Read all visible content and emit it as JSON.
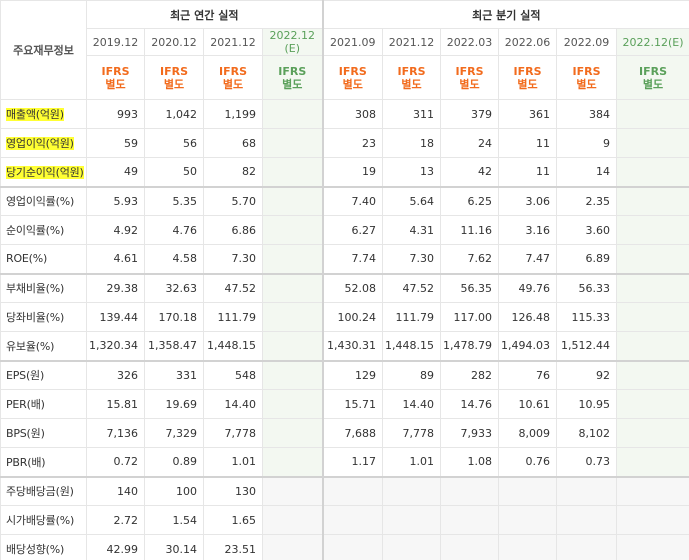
{
  "corner_label": "주요재무정보",
  "group_annual": "최근 연간 실적",
  "group_quarterly": "최근 분기 실적",
  "ifrs_label": "IFRS",
  "separate_label": "별도",
  "columns": [
    {
      "date": "2019.12",
      "est": ""
    },
    {
      "date": "2020.12",
      "est": ""
    },
    {
      "date": "2021.12",
      "est": ""
    },
    {
      "date": "2022.12",
      "est": "(E)"
    },
    {
      "date": "2021.09",
      "est": ""
    },
    {
      "date": "2021.12",
      "est": ""
    },
    {
      "date": "2022.03",
      "est": ""
    },
    {
      "date": "2022.06",
      "est": ""
    },
    {
      "date": "2022.09",
      "est": ""
    },
    {
      "date": "2022.12(E)",
      "est": ""
    }
  ],
  "highlight_color": "#ffff33",
  "accent_color": "#f26b1d",
  "rows": [
    {
      "label": "매출액(억원)",
      "hl": true,
      "values": [
        "993",
        "1,042",
        "1,199",
        "",
        "308",
        "311",
        "379",
        "361",
        "384",
        ""
      ]
    },
    {
      "label": "영업이익(억원)",
      "hl": true,
      "values": [
        "59",
        "56",
        "68",
        "",
        "23",
        "18",
        "24",
        "11",
        "9",
        ""
      ]
    },
    {
      "label": "당기순이익(억원)",
      "hl": true,
      "values": [
        "49",
        "50",
        "82",
        "",
        "19",
        "13",
        "42",
        "11",
        "14",
        ""
      ]
    },
    {
      "label": "영업이익률(%)",
      "hl": false,
      "sep": true,
      "values": [
        "5.93",
        "5.35",
        "5.70",
        "",
        "7.40",
        "5.64",
        "6.25",
        "3.06",
        "2.35",
        ""
      ]
    },
    {
      "label": "순이익률(%)",
      "hl": false,
      "values": [
        "4.92",
        "4.76",
        "6.86",
        "",
        "6.27",
        "4.31",
        "11.16",
        "3.16",
        "3.60",
        ""
      ]
    },
    {
      "label": "ROE(%)",
      "hl": false,
      "values": [
        "4.61",
        "4.58",
        "7.30",
        "",
        "7.74",
        "7.30",
        "7.62",
        "7.47",
        "6.89",
        ""
      ]
    },
    {
      "label": "부채비율(%)",
      "hl": false,
      "sep": true,
      "values": [
        "29.38",
        "32.63",
        "47.52",
        "",
        "52.08",
        "47.52",
        "56.35",
        "49.76",
        "56.33",
        ""
      ]
    },
    {
      "label": "당좌비율(%)",
      "hl": false,
      "values": [
        "139.44",
        "170.18",
        "111.79",
        "",
        "100.24",
        "111.79",
        "117.00",
        "126.48",
        "115.33",
        ""
      ]
    },
    {
      "label": "유보율(%)",
      "hl": false,
      "values": [
        "1,320.34",
        "1,358.47",
        "1,448.15",
        "",
        "1,430.31",
        "1,448.15",
        "1,478.79",
        "1,494.03",
        "1,512.44",
        ""
      ]
    },
    {
      "label": "EPS(원)",
      "hl": false,
      "sep": true,
      "values": [
        "326",
        "331",
        "548",
        "",
        "129",
        "89",
        "282",
        "76",
        "92",
        ""
      ]
    },
    {
      "label": "PER(배)",
      "hl": false,
      "values": [
        "15.81",
        "19.69",
        "14.40",
        "",
        "15.71",
        "14.40",
        "14.76",
        "10.61",
        "10.95",
        ""
      ]
    },
    {
      "label": "BPS(원)",
      "hl": false,
      "values": [
        "7,136",
        "7,329",
        "7,778",
        "",
        "7,688",
        "7,778",
        "7,933",
        "8,009",
        "8,102",
        ""
      ]
    },
    {
      "label": "PBR(배)",
      "hl": false,
      "values": [
        "0.72",
        "0.89",
        "1.01",
        "",
        "1.17",
        "1.01",
        "1.08",
        "0.76",
        "0.73",
        ""
      ]
    },
    {
      "label": "주당배당금(원)",
      "hl": false,
      "sep": true,
      "empty_quarter": true,
      "values": [
        "140",
        "100",
        "130",
        "",
        "",
        "",
        "",
        "",
        "",
        ""
      ]
    },
    {
      "label": "시가배당률(%)",
      "hl": false,
      "empty_quarter": true,
      "values": [
        "2.72",
        "1.54",
        "1.65",
        "",
        "",
        "",
        "",
        "",
        "",
        ""
      ]
    },
    {
      "label": "배당성향(%)",
      "hl": false,
      "empty_quarter": true,
      "values": [
        "42.99",
        "30.14",
        "23.51",
        "",
        "",
        "",
        "",
        "",
        "",
        ""
      ]
    }
  ]
}
